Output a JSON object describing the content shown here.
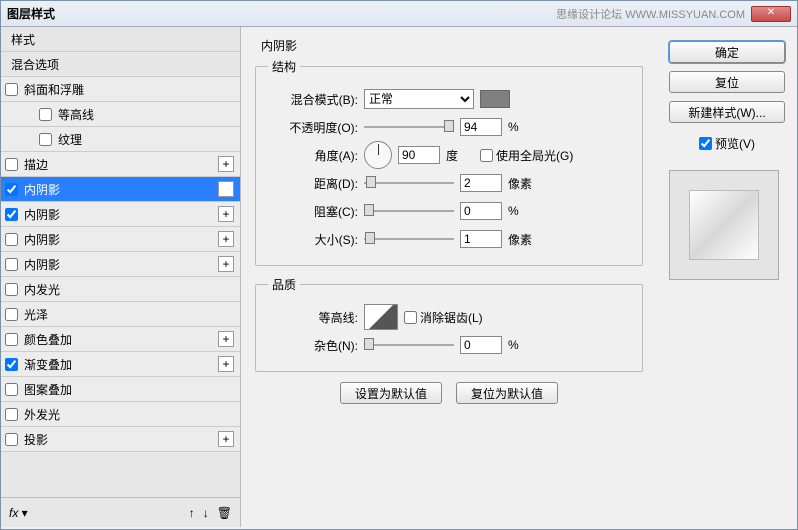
{
  "window": {
    "title": "图层样式",
    "watermark": "思缘设计论坛  WWW.MISSYUAN.COM"
  },
  "styles": {
    "header_styles": "样式",
    "row_blending": "混合选项",
    "rows": [
      {
        "label": "斜面和浮雕",
        "checked": false,
        "plus": false,
        "indent": 0
      },
      {
        "label": "等高线",
        "checked": false,
        "plus": false,
        "indent": 1
      },
      {
        "label": "纹理",
        "checked": false,
        "plus": false,
        "indent": 1
      },
      {
        "label": "描边",
        "checked": false,
        "plus": true,
        "indent": 0
      },
      {
        "label": "内阴影",
        "checked": true,
        "plus": true,
        "indent": 0,
        "selected": true
      },
      {
        "label": "内阴影",
        "checked": true,
        "plus": true,
        "indent": 0
      },
      {
        "label": "内阴影",
        "checked": false,
        "plus": true,
        "indent": 0
      },
      {
        "label": "内阴影",
        "checked": false,
        "plus": true,
        "indent": 0
      },
      {
        "label": "内发光",
        "checked": false,
        "plus": false,
        "indent": 0
      },
      {
        "label": "光泽",
        "checked": false,
        "plus": false,
        "indent": 0
      },
      {
        "label": "颜色叠加",
        "checked": false,
        "plus": true,
        "indent": 0
      },
      {
        "label": "渐变叠加",
        "checked": true,
        "plus": true,
        "indent": 0
      },
      {
        "label": "图案叠加",
        "checked": false,
        "plus": false,
        "indent": 0
      },
      {
        "label": "外发光",
        "checked": false,
        "plus": false,
        "indent": 0
      },
      {
        "label": "投影",
        "checked": false,
        "plus": true,
        "indent": 0
      }
    ],
    "footer_fx": "fx"
  },
  "panel": {
    "title": "内阴影",
    "structure_legend": "结构",
    "blend_mode_label": "混合模式(B):",
    "blend_mode_value": "正常",
    "opacity_label": "不透明度(O):",
    "opacity_value": "94",
    "opacity_unit": "%",
    "angle_label": "角度(A):",
    "angle_value": "90",
    "angle_unit": "度",
    "global_light_label": "使用全局光(G)",
    "global_light_checked": false,
    "distance_label": "距离(D):",
    "distance_value": "2",
    "distance_unit": "像素",
    "choke_label": "阻塞(C):",
    "choke_value": "0",
    "choke_unit": "%",
    "size_label": "大小(S):",
    "size_value": "1",
    "size_unit": "像素",
    "quality_legend": "品质",
    "contour_label": "等高线:",
    "antialias_label": "消除锯齿(L)",
    "antialias_checked": false,
    "noise_label": "杂色(N):",
    "noise_value": "0",
    "noise_unit": "%",
    "btn_default": "设置为默认值",
    "btn_reset": "复位为默认值"
  },
  "right": {
    "ok": "确定",
    "cancel": "复位",
    "new_style": "新建样式(W)...",
    "preview_label": "预览(V)",
    "preview_checked": true
  }
}
